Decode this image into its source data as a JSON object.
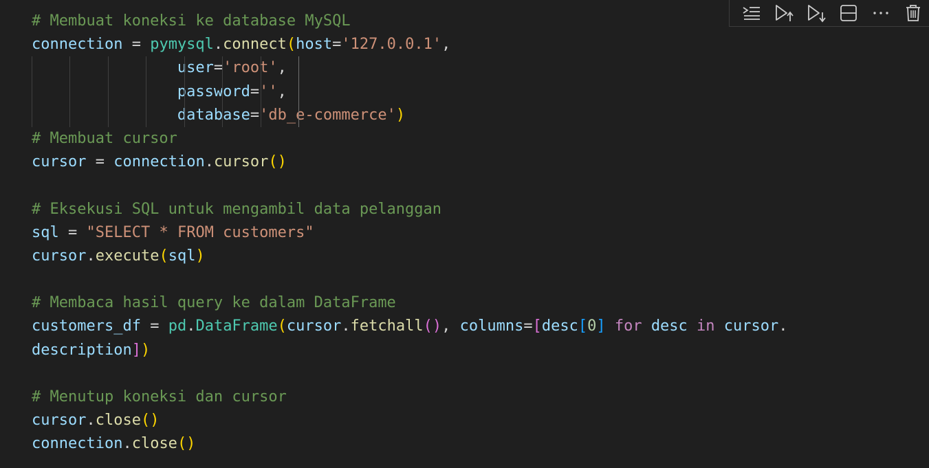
{
  "editor": {
    "language": "python",
    "lines": [
      [
        {
          "t": "# Membuat koneksi ke database MySQL",
          "c": "comment"
        }
      ],
      [
        {
          "t": "connection",
          "c": "var"
        },
        {
          "t": " = ",
          "c": "op"
        },
        {
          "t": "pymysql",
          "c": "module"
        },
        {
          "t": ".",
          "c": "punc"
        },
        {
          "t": "connect",
          "c": "func"
        },
        {
          "t": "(",
          "c": "b1"
        },
        {
          "t": "host",
          "c": "param"
        },
        {
          "t": "=",
          "c": "op"
        },
        {
          "t": "'127.0.0.1'",
          "c": "string"
        },
        {
          "t": ",",
          "c": "punc"
        }
      ],
      [
        {
          "t": "                ",
          "c": "punc"
        },
        {
          "t": "user",
          "c": "param"
        },
        {
          "t": "=",
          "c": "op"
        },
        {
          "t": "'root'",
          "c": "string"
        },
        {
          "t": ",",
          "c": "punc"
        }
      ],
      [
        {
          "t": "                ",
          "c": "punc"
        },
        {
          "t": "password",
          "c": "param"
        },
        {
          "t": "=",
          "c": "op"
        },
        {
          "t": "''",
          "c": "string"
        },
        {
          "t": ",",
          "c": "punc"
        }
      ],
      [
        {
          "t": "                ",
          "c": "punc"
        },
        {
          "t": "database",
          "c": "param"
        },
        {
          "t": "=",
          "c": "op"
        },
        {
          "t": "'db_e-commerce'",
          "c": "string"
        },
        {
          "t": ")",
          "c": "b1"
        }
      ],
      [
        {
          "t": "# Membuat cursor",
          "c": "comment"
        }
      ],
      [
        {
          "t": "cursor",
          "c": "var"
        },
        {
          "t": " = ",
          "c": "op"
        },
        {
          "t": "connection",
          "c": "var"
        },
        {
          "t": ".",
          "c": "punc"
        },
        {
          "t": "cursor",
          "c": "func"
        },
        {
          "t": "()",
          "c": "b1"
        }
      ],
      [],
      [
        {
          "t": "# Eksekusi SQL untuk mengambil data pelanggan",
          "c": "comment"
        }
      ],
      [
        {
          "t": "sql",
          "c": "var"
        },
        {
          "t": " = ",
          "c": "op"
        },
        {
          "t": "\"SELECT * FROM customers\"",
          "c": "string"
        }
      ],
      [
        {
          "t": "cursor",
          "c": "var"
        },
        {
          "t": ".",
          "c": "punc"
        },
        {
          "t": "execute",
          "c": "func"
        },
        {
          "t": "(",
          "c": "b1"
        },
        {
          "t": "sql",
          "c": "var"
        },
        {
          "t": ")",
          "c": "b1"
        }
      ],
      [],
      [
        {
          "t": "# Membaca hasil query ke dalam DataFrame",
          "c": "comment"
        }
      ],
      [
        {
          "t": "customers_df",
          "c": "var"
        },
        {
          "t": " = ",
          "c": "op"
        },
        {
          "t": "pd",
          "c": "module"
        },
        {
          "t": ".",
          "c": "punc"
        },
        {
          "t": "DataFrame",
          "c": "class"
        },
        {
          "t": "(",
          "c": "b1"
        },
        {
          "t": "cursor",
          "c": "var"
        },
        {
          "t": ".",
          "c": "punc"
        },
        {
          "t": "fetchall",
          "c": "func"
        },
        {
          "t": "()",
          "c": "b2"
        },
        {
          "t": ", ",
          "c": "punc"
        },
        {
          "t": "columns",
          "c": "param"
        },
        {
          "t": "=",
          "c": "op"
        },
        {
          "t": "[",
          "c": "b2"
        },
        {
          "t": "desc",
          "c": "var"
        },
        {
          "t": "[",
          "c": "b3"
        },
        {
          "t": "0",
          "c": "number"
        },
        {
          "t": "]",
          "c": "b3"
        },
        {
          "t": " for ",
          "c": "keyword"
        },
        {
          "t": "desc",
          "c": "var"
        },
        {
          "t": " in ",
          "c": "keyword"
        },
        {
          "t": "cursor",
          "c": "var"
        },
        {
          "t": ".",
          "c": "punc"
        }
      ],
      [
        {
          "t": "description",
          "c": "var"
        },
        {
          "t": "]",
          "c": "b2"
        },
        {
          "t": ")",
          "c": "b1"
        }
      ],
      [],
      [
        {
          "t": "# Menutup koneksi dan cursor",
          "c": "comment"
        }
      ],
      [
        {
          "t": "cursor",
          "c": "var"
        },
        {
          "t": ".",
          "c": "punc"
        },
        {
          "t": "close",
          "c": "func"
        },
        {
          "t": "()",
          "c": "b1"
        }
      ],
      [
        {
          "t": "connection",
          "c": "var"
        },
        {
          "t": ".",
          "c": "punc"
        },
        {
          "t": "close",
          "c": "func"
        },
        {
          "t": "()",
          "c": "b1"
        }
      ]
    ]
  },
  "toolbar": {
    "buttons": [
      {
        "name": "execute-above-cells-icon"
      },
      {
        "name": "run-above-icon"
      },
      {
        "name": "run-below-icon"
      },
      {
        "name": "split-cell-icon"
      },
      {
        "name": "more-actions-icon"
      },
      {
        "name": "delete-cell-icon"
      }
    ]
  },
  "colors": {
    "background": "#1f1f1f",
    "comment": "#6a9955",
    "variable": "#9cdcfe",
    "function": "#dcdcaa",
    "string": "#ce9178",
    "keyword": "#c586c0",
    "class": "#4ec9b0",
    "bracket_level1": "#ffd700",
    "bracket_level2": "#da70d6",
    "bracket_level3": "#179fff"
  }
}
